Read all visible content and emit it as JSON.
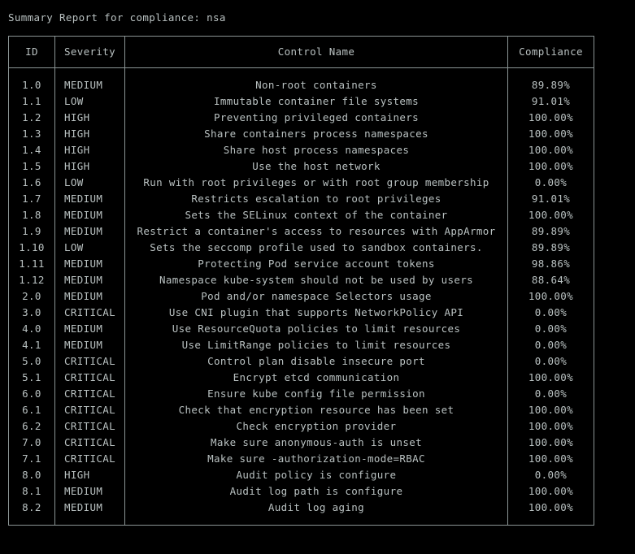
{
  "terminal": {
    "title_line": "Summary Report for compliance: nsa",
    "background_color": "#000000",
    "text_color": "#b9c1c1",
    "border_color": "#8b9595"
  },
  "table": {
    "columns": [
      {
        "key": "id",
        "label": "ID"
      },
      {
        "key": "severity",
        "label": "Severity"
      },
      {
        "key": "control_name",
        "label": "Control Name"
      },
      {
        "key": "compliance",
        "label": "Compliance"
      }
    ],
    "rows": [
      {
        "id": "1.0",
        "severity": "MEDIUM",
        "control_name": "Non-root containers",
        "compliance": "89.89%"
      },
      {
        "id": "1.1",
        "severity": "LOW",
        "control_name": "Immutable container file systems",
        "compliance": "91.01%"
      },
      {
        "id": "1.2",
        "severity": "HIGH",
        "control_name": "Preventing privileged containers",
        "compliance": "100.00%"
      },
      {
        "id": "1.3",
        "severity": "HIGH",
        "control_name": "Share containers process namespaces",
        "compliance": "100.00%"
      },
      {
        "id": "1.4",
        "severity": "HIGH",
        "control_name": "Share host process namespaces",
        "compliance": "100.00%"
      },
      {
        "id": "1.5",
        "severity": "HIGH",
        "control_name": "Use the host network",
        "compliance": "100.00%"
      },
      {
        "id": "1.6",
        "severity": "LOW",
        "control_name": "Run with root privileges or with root group membership",
        "compliance": "0.00%"
      },
      {
        "id": "1.7",
        "severity": "MEDIUM",
        "control_name": "Restricts escalation to root privileges",
        "compliance": "91.01%"
      },
      {
        "id": "1.8",
        "severity": "MEDIUM",
        "control_name": "Sets the SELinux context of the container",
        "compliance": "100.00%"
      },
      {
        "id": "1.9",
        "severity": "MEDIUM",
        "control_name": "Restrict a container's access to resources with AppArmor",
        "compliance": "89.89%"
      },
      {
        "id": "1.10",
        "severity": "LOW",
        "control_name": "Sets the seccomp profile used to sandbox containers.",
        "compliance": "89.89%"
      },
      {
        "id": "1.11",
        "severity": "MEDIUM",
        "control_name": "Protecting Pod service account tokens",
        "compliance": "98.86%"
      },
      {
        "id": "1.12",
        "severity": "MEDIUM",
        "control_name": "Namespace kube-system should not be used by users",
        "compliance": "88.64%"
      },
      {
        "id": "2.0",
        "severity": "MEDIUM",
        "control_name": "Pod and/or namespace Selectors usage",
        "compliance": "100.00%"
      },
      {
        "id": "3.0",
        "severity": "CRITICAL",
        "control_name": "Use CNI plugin that supports NetworkPolicy API",
        "compliance": "0.00%"
      },
      {
        "id": "4.0",
        "severity": "MEDIUM",
        "control_name": "Use ResourceQuota policies to limit resources",
        "compliance": "0.00%"
      },
      {
        "id": "4.1",
        "severity": "MEDIUM",
        "control_name": "Use LimitRange policies to limit resources",
        "compliance": "0.00%"
      },
      {
        "id": "5.0",
        "severity": "CRITICAL",
        "control_name": "Control plan disable insecure port",
        "compliance": "0.00%"
      },
      {
        "id": "5.1",
        "severity": "CRITICAL",
        "control_name": "Encrypt etcd communication",
        "compliance": "100.00%"
      },
      {
        "id": "6.0",
        "severity": "CRITICAL",
        "control_name": "Ensure kube config file permission",
        "compliance": "0.00%"
      },
      {
        "id": "6.1",
        "severity": "CRITICAL",
        "control_name": "Check that encryption resource has been set",
        "compliance": "100.00%"
      },
      {
        "id": "6.2",
        "severity": "CRITICAL",
        "control_name": "Check encryption provider",
        "compliance": "100.00%"
      },
      {
        "id": "7.0",
        "severity": "CRITICAL",
        "control_name": "Make sure anonymous-auth is unset",
        "compliance": "100.00%"
      },
      {
        "id": "7.1",
        "severity": "CRITICAL",
        "control_name": "Make sure -authorization-mode=RBAC",
        "compliance": "100.00%"
      },
      {
        "id": "8.0",
        "severity": "HIGH",
        "control_name": "Audit policy is configure",
        "compliance": "0.00%"
      },
      {
        "id": "8.1",
        "severity": "MEDIUM",
        "control_name": "Audit log path is configure",
        "compliance": "100.00%"
      },
      {
        "id": "8.2",
        "severity": "MEDIUM",
        "control_name": "Audit log aging",
        "compliance": "100.00%"
      }
    ]
  }
}
